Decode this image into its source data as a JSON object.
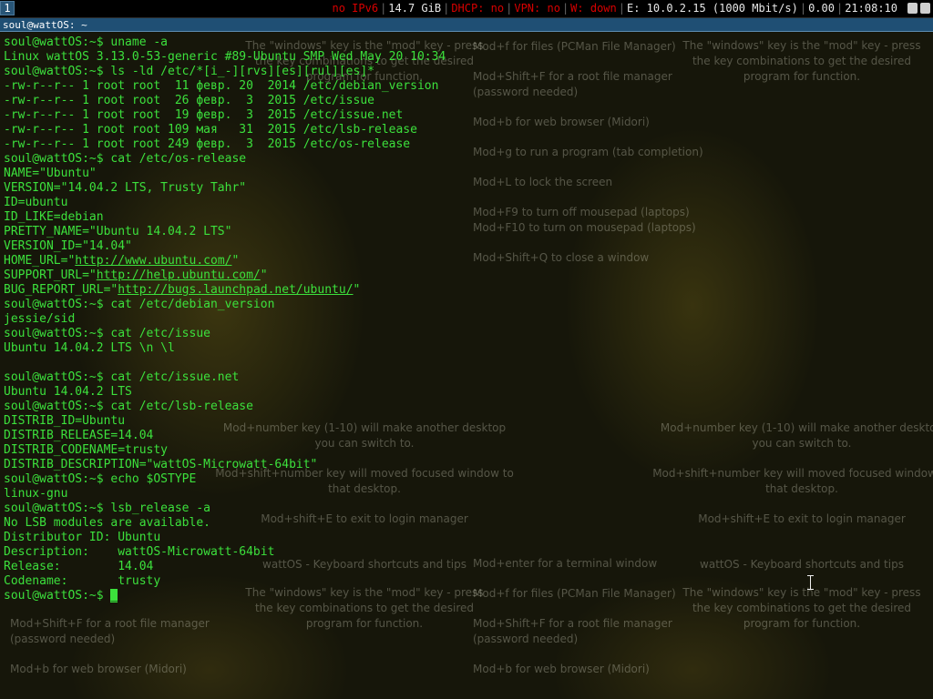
{
  "topbar": {
    "workspace": "1",
    "ipv6": "no IPv6",
    "disk": "14.7 GiB",
    "dhcp": "DHCP: no",
    "vpn": "VPN: no",
    "wireless": "W: down",
    "ethernet": "E: 10.0.2.15 (1000 Mbit/s)",
    "load": "0.00",
    "time": "21:08:10",
    "colors": {
      "warning": "#d80000",
      "normal": "#e8e8e8",
      "terminal_green": "#3ce03c",
      "title_bar": "#1f4f74"
    }
  },
  "window": {
    "title": "soul@wattOS: ~"
  },
  "terminal": {
    "lines": [
      "soul@wattOS:~$ uname -a",
      "Linux wattOS 3.13.0-53-generic #89-Ubuntu SMP Wed May 20 10:34",
      "soul@wattOS:~$ ls -ld /etc/*[i_-][rvs][es][rul][es]*",
      "-rw-r--r-- 1 root root  11 февр. 20  2014 /etc/debian_version",
      "-rw-r--r-- 1 root root  26 февр.  3  2015 /etc/issue",
      "-rw-r--r-- 1 root root  19 февр.  3  2015 /etc/issue.net",
      "-rw-r--r-- 1 root root 109 мая   31  2015 /etc/lsb-release",
      "-rw-r--r-- 1 root root 249 февр.  3  2015 /etc/os-release",
      "soul@wattOS:~$ cat /etc/os-release",
      "NAME=\"Ubuntu\"",
      "VERSION=\"14.04.2 LTS, Trusty Tahr\"",
      "ID=ubuntu",
      "ID_LIKE=debian",
      "PRETTY_NAME=\"Ubuntu 14.04.2 LTS\"",
      "VERSION_ID=\"14.04\"",
      "HOME_URL=\"",
      "SUPPORT_URL=\"",
      "BUG_REPORT_URL=\"",
      "soul@wattOS:~$ cat /etc/debian_version",
      "jessie/sid",
      "soul@wattOS:~$ cat /etc/issue",
      "Ubuntu 14.04.2 LTS \\n \\l",
      "",
      "soul@wattOS:~$ cat /etc/issue.net",
      "Ubuntu 14.04.2 LTS",
      "soul@wattOS:~$ cat /etc/lsb-release",
      "DISTRIB_ID=Ubuntu",
      "DISTRIB_RELEASE=14.04",
      "DISTRIB_CODENAME=trusty",
      "DISTRIB_DESCRIPTION=\"wattOS-Microwatt-64bit\"",
      "soul@wattOS:~$ echo $OSTYPE",
      "linux-gnu",
      "soul@wattOS:~$ lsb_release -a",
      "No LSB modules are available.",
      "Distributor ID: Ubuntu",
      "Description:    wattOS-Microwatt-64bit",
      "Release:        14.04",
      "Codename:       trusty",
      "soul@wattOS:~$ "
    ],
    "links": {
      "home": "http://www.ubuntu.com/",
      "support": "http://help.ubuntu.com/",
      "bug": "http://bugs.launchpad.net/ubuntu/"
    },
    "cursor_char": "_"
  },
  "wallpaper": {
    "mod_key": "The \"windows\" key is the \"mod\" key - press",
    "mod_key_2": "the key combinations to get the desired",
    "mod_key_3": "program for function.",
    "files": "Mod+f for files (PCMan File Manager)",
    "root_fm": "Mod+Shift+F for a root file manager",
    "root_fm_2": "(password needed)",
    "browser": "Mod+b for web browser (Midori)",
    "run": "Mod+g to run a program (tab completion)",
    "lock": "Mod+L to lock the screen",
    "mousepad_off": "Mod+F9 to turn off mousepad (laptops)",
    "mousepad_on": "Mod+F10 to turn on mousepad (laptops)",
    "close": "Mod+Shift+Q to close a window",
    "desktop": "Mod+number key (1-10) will make another desktop",
    "desktop_2": "you can switch to.",
    "move": "Mod+shift+number key will moved focused window to",
    "move_2": "that desktop.",
    "exit": "Mod+shift+E to exit to login manager",
    "enter": "Mod+enter for a terminal window",
    "shortcuts": "wattOS - Keyboard shortcuts and tips"
  }
}
